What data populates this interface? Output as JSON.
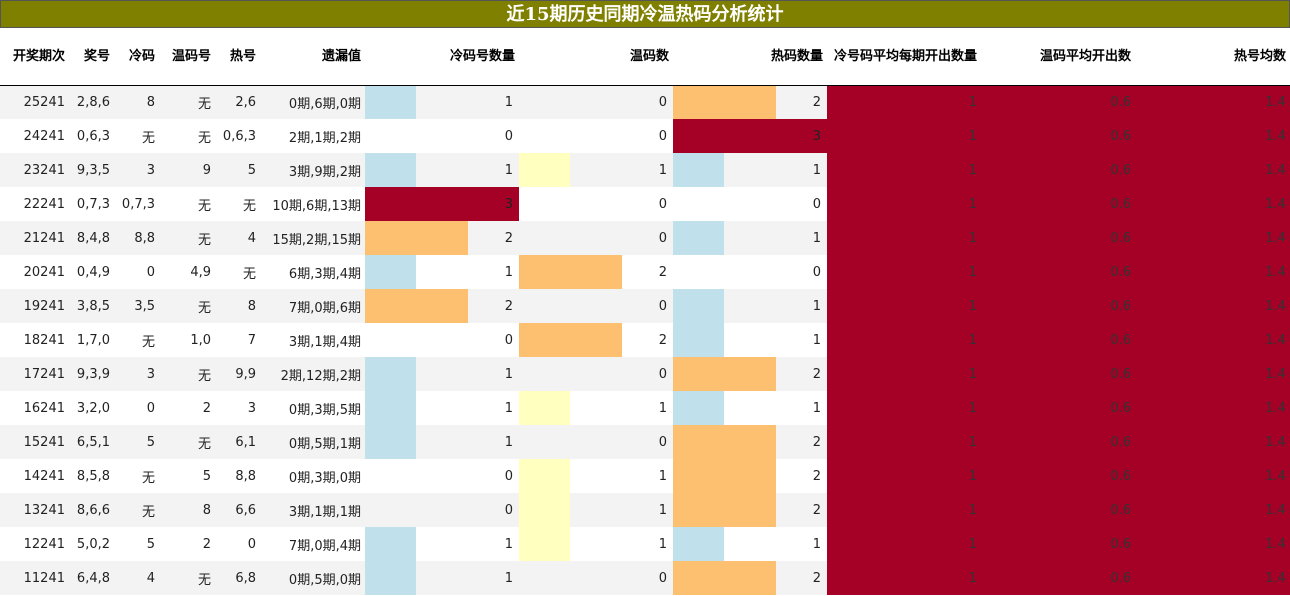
{
  "title": "近15期历史同期冷温热码分析统计",
  "colors": {
    "header_bg": "#808000",
    "one_color": "#c0e0ec",
    "two_color": "#fdc070",
    "three_color": "#a50026",
    "warm_one_color": "#ffffc0"
  },
  "columns": [
    "开奖期次",
    "奖号",
    "冷码",
    "温码号",
    "热号",
    "遗漏值",
    "冷码号数量",
    "温码数",
    "热码数量",
    "冷号码平均每期开出数量",
    "温码平均开出数",
    "热号均数"
  ],
  "max_count": 3,
  "rows": [
    {
      "issue": "25241",
      "prize": "2,8,6",
      "cold": "8",
      "warm": "无",
      "hot": "2,6",
      "missing": "0期,6期,0期",
      "cold_count": "1",
      "warm_count": "0",
      "hot_count": "2",
      "avg_cold": "1",
      "avg_warm": "0.6",
      "avg_hot": "1.4"
    },
    {
      "issue": "24241",
      "prize": "0,6,3",
      "cold": "无",
      "warm": "无",
      "hot": "0,6,3",
      "missing": "2期,1期,2期",
      "cold_count": "0",
      "warm_count": "0",
      "hot_count": "3",
      "avg_cold": "1",
      "avg_warm": "0.6",
      "avg_hot": "1.4"
    },
    {
      "issue": "23241",
      "prize": "9,3,5",
      "cold": "3",
      "warm": "9",
      "hot": "5",
      "missing": "3期,9期,2期",
      "cold_count": "1",
      "warm_count": "1",
      "hot_count": "1",
      "avg_cold": "1",
      "avg_warm": "0.6",
      "avg_hot": "1.4"
    },
    {
      "issue": "22241",
      "prize": "0,7,3",
      "cold": "0,7,3",
      "warm": "无",
      "hot": "无",
      "missing": "10期,6期,13期",
      "cold_count": "3",
      "warm_count": "0",
      "hot_count": "0",
      "avg_cold": "1",
      "avg_warm": "0.6",
      "avg_hot": "1.4"
    },
    {
      "issue": "21241",
      "prize": "8,4,8",
      "cold": "8,8",
      "warm": "无",
      "hot": "4",
      "missing": "15期,2期,15期",
      "cold_count": "2",
      "warm_count": "0",
      "hot_count": "1",
      "avg_cold": "1",
      "avg_warm": "0.6",
      "avg_hot": "1.4"
    },
    {
      "issue": "20241",
      "prize": "0,4,9",
      "cold": "0",
      "warm": "4,9",
      "hot": "无",
      "missing": "6期,3期,4期",
      "cold_count": "1",
      "warm_count": "2",
      "hot_count": "0",
      "avg_cold": "1",
      "avg_warm": "0.6",
      "avg_hot": "1.4"
    },
    {
      "issue": "19241",
      "prize": "3,8,5",
      "cold": "3,5",
      "warm": "无",
      "hot": "8",
      "missing": "7期,0期,6期",
      "cold_count": "2",
      "warm_count": "0",
      "hot_count": "1",
      "avg_cold": "1",
      "avg_warm": "0.6",
      "avg_hot": "1.4"
    },
    {
      "issue": "18241",
      "prize": "1,7,0",
      "cold": "无",
      "warm": "1,0",
      "hot": "7",
      "missing": "3期,1期,4期",
      "cold_count": "0",
      "warm_count": "2",
      "hot_count": "1",
      "avg_cold": "1",
      "avg_warm": "0.6",
      "avg_hot": "1.4"
    },
    {
      "issue": "17241",
      "prize": "9,3,9",
      "cold": "3",
      "warm": "无",
      "hot": "9,9",
      "missing": "2期,12期,2期",
      "cold_count": "1",
      "warm_count": "0",
      "hot_count": "2",
      "avg_cold": "1",
      "avg_warm": "0.6",
      "avg_hot": "1.4"
    },
    {
      "issue": "16241",
      "prize": "3,2,0",
      "cold": "0",
      "warm": "2",
      "hot": "3",
      "missing": "0期,3期,5期",
      "cold_count": "1",
      "warm_count": "1",
      "hot_count": "1",
      "avg_cold": "1",
      "avg_warm": "0.6",
      "avg_hot": "1.4"
    },
    {
      "issue": "15241",
      "prize": "6,5,1",
      "cold": "5",
      "warm": "无",
      "hot": "6,1",
      "missing": "0期,5期,1期",
      "cold_count": "1",
      "warm_count": "0",
      "hot_count": "2",
      "avg_cold": "1",
      "avg_warm": "0.6",
      "avg_hot": "1.4"
    },
    {
      "issue": "14241",
      "prize": "8,5,8",
      "cold": "无",
      "warm": "5",
      "hot": "8,8",
      "missing": "0期,3期,0期",
      "cold_count": "0",
      "warm_count": "1",
      "hot_count": "2",
      "avg_cold": "1",
      "avg_warm": "0.6",
      "avg_hot": "1.4"
    },
    {
      "issue": "13241",
      "prize": "8,6,6",
      "cold": "无",
      "warm": "8",
      "hot": "6,6",
      "missing": "3期,1期,1期",
      "cold_count": "0",
      "warm_count": "1",
      "hot_count": "2",
      "avg_cold": "1",
      "avg_warm": "0.6",
      "avg_hot": "1.4"
    },
    {
      "issue": "12241",
      "prize": "5,0,2",
      "cold": "5",
      "warm": "2",
      "hot": "0",
      "missing": "7期,0期,4期",
      "cold_count": "1",
      "warm_count": "1",
      "hot_count": "1",
      "avg_cold": "1",
      "avg_warm": "0.6",
      "avg_hot": "1.4"
    },
    {
      "issue": "11241",
      "prize": "6,4,8",
      "cold": "4",
      "warm": "无",
      "hot": "6,8",
      "missing": "0期,5期,0期",
      "cold_count": "1",
      "warm_count": "0",
      "hot_count": "2",
      "avg_cold": "1",
      "avg_warm": "0.6",
      "avg_hot": "1.4"
    }
  ]
}
